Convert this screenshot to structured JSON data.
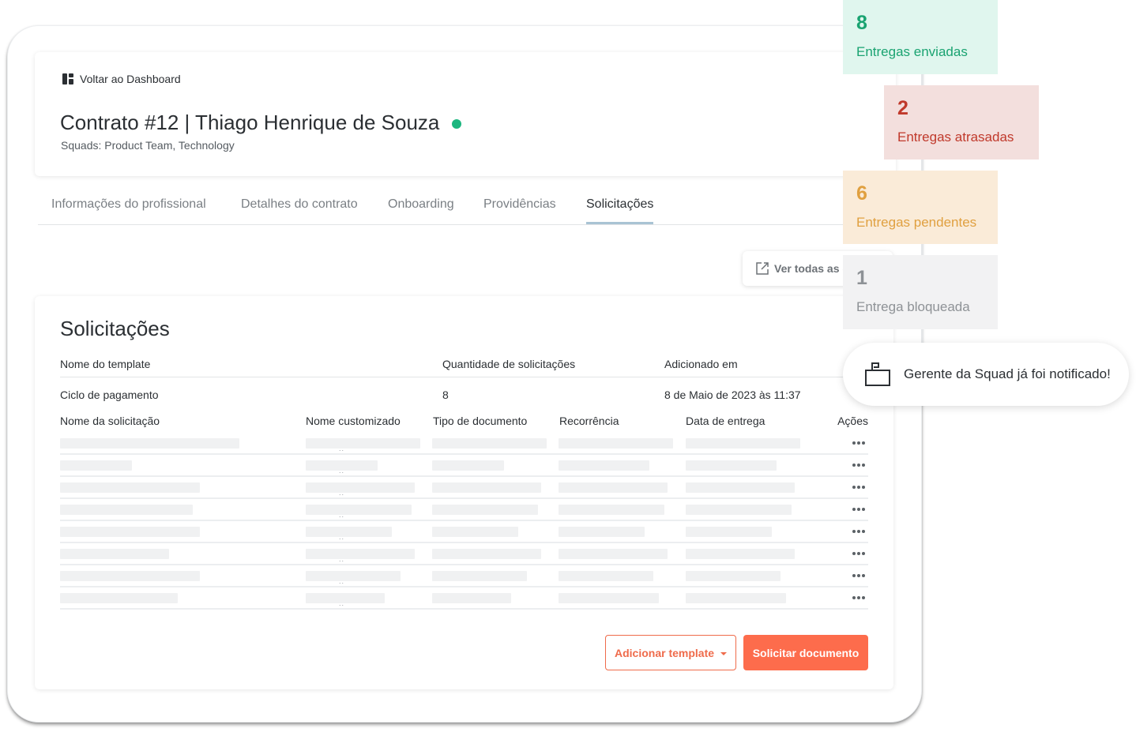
{
  "header": {
    "back_label": "Voltar ao Dashboard",
    "contract_title": "Contrato #12 | Thiago Henrique de Souza",
    "squads": "Squads: Product Team, Technology"
  },
  "tabs": [
    {
      "label": "Informações do profissional",
      "active": false
    },
    {
      "label": "Detalhes do contrato",
      "active": false
    },
    {
      "label": "Onboarding",
      "active": false
    },
    {
      "label": "Providências",
      "active": false
    },
    {
      "label": "Solicitações",
      "active": true
    }
  ],
  "see_all_label": "Ver todas as e",
  "section": {
    "title": "Solicitações",
    "template_columns": [
      "Nome do template",
      "Quantidade de solicitações",
      "Adicionado em"
    ],
    "template_row": {
      "name": "Ciclo de pagamento",
      "count": "8",
      "added": "8 de Maio de 2023 às 11:37"
    },
    "request_columns": [
      "Nome da solicitação",
      "Nome customizado",
      "Tipo de documento",
      "Recorrência",
      "Data de entrega",
      "Ações"
    ],
    "request_rows_loading": 8,
    "add_template_label": "Adicionar template",
    "request_document_label": "Solicitar documento"
  },
  "stats": [
    {
      "value": "8",
      "label": "Entregas enviadas",
      "bg": "#e0f6ee",
      "color": "#1aa371"
    },
    {
      "value": "2",
      "label": "Entregas atrasadas",
      "bg": "#f3dfdd",
      "color": "#c0392b"
    },
    {
      "value": "6",
      "label": "Entregas pendentes",
      "bg": "#faebd8",
      "color": "#e0a040"
    },
    {
      "value": "1",
      "label": "Entrega bloqueada",
      "bg": "#f2f2f3",
      "color": "#8e9296"
    }
  ],
  "notification": {
    "icon": "mailbox-icon",
    "text": "Gerente da Squad já foi notificado!"
  },
  "colors": {
    "accent": "#fd6c4c",
    "status_active": "#1cb67f",
    "tab_underline": "#a9c3d4"
  }
}
